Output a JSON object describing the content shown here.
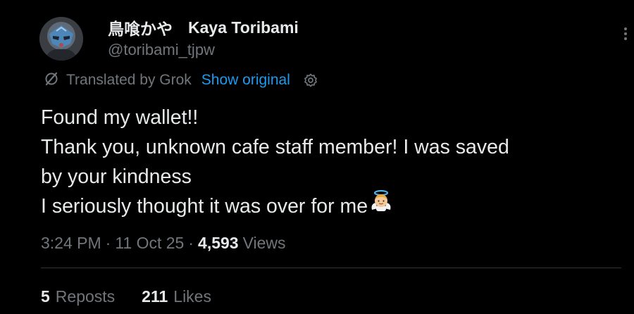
{
  "author": {
    "display_name": "鳥喰かや",
    "subname": "Kaya Toribami",
    "handle": "@toribami_tjpw"
  },
  "translation": {
    "label": "Translated by Grok",
    "show_original": "Show original",
    "icon": "translate-off-icon"
  },
  "tweet": {
    "lines": [
      "Found my wallet!!",
      "Thank you, unknown cafe staff member! I was saved",
      "by your kindness",
      "I seriously thought it was over for me"
    ],
    "emoji": "angel-emoji"
  },
  "meta": {
    "time": "3:24 PM",
    "separator": "·",
    "date": "11 Oct 25",
    "views_count": "4,593",
    "views_label": "Views"
  },
  "stats": {
    "reposts_count": "5",
    "reposts_label": "Reposts",
    "likes_count": "211",
    "likes_label": "Likes"
  },
  "colors": {
    "background": "#000000",
    "text": "#e7e9ea",
    "muted": "#71767b",
    "link": "#1d9bf0",
    "divider": "#2f3336"
  },
  "icons": [
    "more-icon",
    "translate-off-icon",
    "settings-icon",
    "angel-emoji"
  ]
}
